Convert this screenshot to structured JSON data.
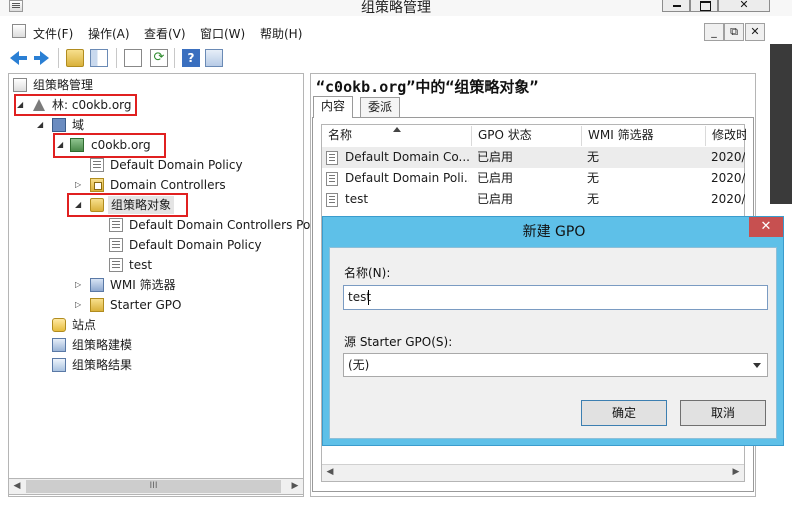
{
  "window": {
    "title": "组策略管理",
    "close_glyph": "✕"
  },
  "menu": {
    "file": "文件(F)",
    "action": "操作(A)",
    "view": "查看(V)",
    "window": "窗口(W)",
    "help": "帮助(H)",
    "mdi_min": "_",
    "mdi_restore": "⧉",
    "mdi_close": "✕"
  },
  "toolbar": {
    "help_glyph": "?"
  },
  "tree": {
    "root": "组策略管理",
    "forest": "林: c0okb.org",
    "domains": "域",
    "domain": "c0okb.org",
    "default_domain_policy_link": "Default Domain Policy",
    "domain_controllers": "Domain Controllers",
    "gpo_container": "组策略对象",
    "gpo_items": [
      "Default Domain Controllers Po",
      "Default Domain Policy",
      "test"
    ],
    "wmi_filters": "WMI 筛选器",
    "starter_gpos": "Starter GPO",
    "sites": "站点",
    "modeling": "组策略建模",
    "results": "组策略结果"
  },
  "scroll": {
    "left": "◀",
    "right": "▶",
    "grip": "III"
  },
  "right": {
    "title": "“c0okb.org”中的“组策略对象”",
    "tabs": [
      "内容",
      "委派"
    ],
    "columns": [
      "名称",
      "GPO 状态",
      "WMI 筛选器",
      "修改时"
    ],
    "rows": [
      {
        "name": "Default Domain Co...",
        "status": "已启用",
        "wmi": "无",
        "modified": "2020/"
      },
      {
        "name": "Default Domain Poli...",
        "status": "已启用",
        "wmi": "无",
        "modified": "2020/"
      },
      {
        "name": "test",
        "status": "已启用",
        "wmi": "无",
        "modified": "2020/"
      }
    ]
  },
  "dialog": {
    "title": "新建 GPO",
    "close_glyph": "✕",
    "name_label": "名称(N):",
    "name_value": "test",
    "starter_label": "源 Starter GPO(S):",
    "starter_value": "(无)",
    "ok": "确定",
    "cancel": "取消"
  },
  "colors": {
    "dialog_frame": "#5ec0e8",
    "dialog_close": "#c75050",
    "highlight_box": "#e02020"
  }
}
